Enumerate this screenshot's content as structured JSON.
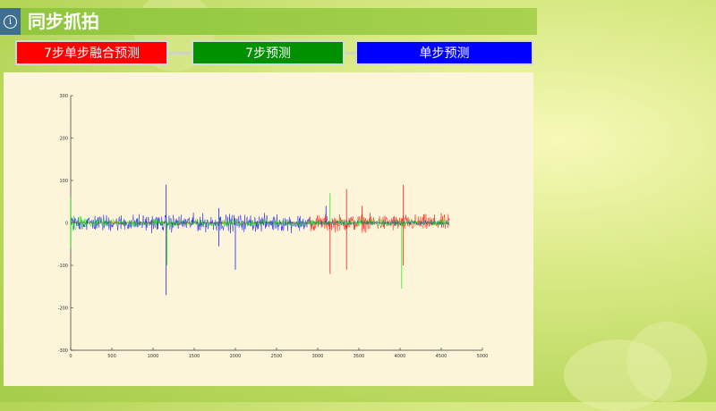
{
  "header": {
    "title": "同步抓拍",
    "icon": "info-icon"
  },
  "tabs": [
    {
      "label": "7步单步融合预测",
      "color": "#ff0000"
    },
    {
      "label": "7步预测",
      "color": "#009000"
    },
    {
      "label": "单步预测",
      "color": "#0000ff"
    }
  ],
  "chart_data": {
    "type": "line",
    "title": "",
    "xlabel": "",
    "ylabel": "",
    "xlim": [
      0,
      5000
    ],
    "ylim": [
      -300,
      300
    ],
    "x_ticks": [
      "0",
      "500",
      "1000",
      "1500",
      "2000",
      "2500",
      "3000",
      "3500",
      "4000",
      "4500",
      "5000"
    ],
    "y_ticks": [
      "300",
      "200",
      "100",
      "0",
      "-100",
      "-200",
      "-300"
    ],
    "series": [
      {
        "color": "#ff0000",
        "x_range": [
          0,
          4600
        ],
        "amplitude": 20,
        "spikes": [
          [
            3150,
            -120
          ],
          [
            3350,
            80
          ],
          [
            3350,
            -110
          ],
          [
            3540,
            40
          ],
          [
            4040,
            90
          ],
          [
            4040,
            -100
          ]
        ]
      },
      {
        "color": "#0000ff",
        "x_range": [
          0,
          4600
        ],
        "amplitude": 22,
        "spikes": [
          [
            1160,
            90
          ],
          [
            1160,
            -170
          ],
          [
            1800,
            35
          ],
          [
            1800,
            -55
          ],
          [
            2000,
            -110
          ],
          [
            3100,
            40
          ]
        ]
      },
      {
        "color": "#00ee00",
        "x_range": [
          0,
          4600
        ],
        "amplitude": 12,
        "spikes": [
          [
            0,
            60
          ],
          [
            0,
            -60
          ],
          [
            1170,
            -100
          ],
          [
            3150,
            70
          ],
          [
            4020,
            -155
          ]
        ]
      }
    ]
  }
}
